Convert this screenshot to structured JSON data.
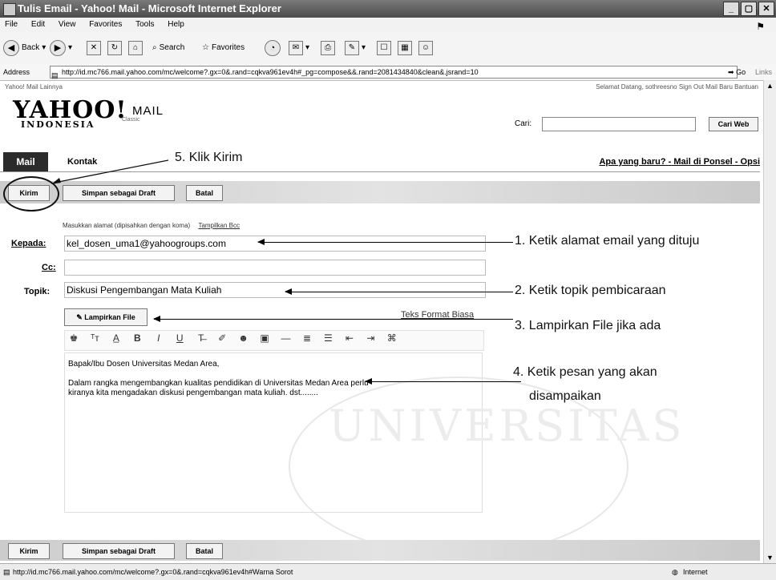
{
  "window": {
    "title": "Tulis Email - Yahoo! Mail - Microsoft Internet Explorer"
  },
  "menu": [
    "File",
    "Edit",
    "View",
    "Favorites",
    "Tools",
    "Help"
  ],
  "toolbar": {
    "back": "Back",
    "search": "Search",
    "favorites": "Favorites"
  },
  "address": {
    "label": "Address",
    "url": "http://id.mc766.mail.yahoo.com/mc/welcome?.gx=0&.rand=cqkva961ev4h#_pg=compose&&.rand=2081434840&clean&.jsrand=10",
    "go": "Go",
    "links": "Links"
  },
  "toplinks": {
    "left": "Yahoo!  Mail  Lainnya",
    "right": "Selamat Datang, sothreesno  Sign Out   Mail Baru   Bantuan"
  },
  "logo": {
    "brand": "YAHOO!",
    "product": "MAIL",
    "region": "INDONESIA",
    "edition": "Classic"
  },
  "search": {
    "label": "Cari:",
    "button": "Cari Web"
  },
  "tabs": {
    "mail": "Mail",
    "kontak": "Kontak"
  },
  "headerlinks": {
    "new": "Apa yang baru?",
    "mobile": "Mail di Ponsel",
    "options": "Opsi",
    "sep": "-"
  },
  "buttons": {
    "send": "Kirim",
    "draft": "Simpan sebagai Draft",
    "cancel": "Batal"
  },
  "form": {
    "hint": "Masukkan alamat (dipisahkan dengan koma)",
    "hint_link": "Tampilkan Bcc",
    "to_label": "Kepada:",
    "to_value": "kel_dosen_uma1@yahoogroups.com",
    "cc_label": "Cc:",
    "cc_value": "",
    "subject_label": "Topik:",
    "subject_value": "Diskusi Pengembangan Mata Kuliah",
    "attach_button": "Lampirkan File",
    "plain_text_link": "Teks Format Biasa",
    "body_line1": "Bapak/Ibu Dosen Universitas Medan Area,",
    "body_line2": "Dalam rangka mengembangkan kualitas pendidikan di Universitas Medan Area perlu",
    "body_line3": "kiranya kita mengadakan diskusi pengembangan mata kuliah. dst........"
  },
  "annotations": {
    "step1": "1. Ketik alamat email yang dituju",
    "step2": "2. Ketik topik pembicaraan",
    "step3": "3. Lampirkan File jika ada",
    "step4a": "4. Ketik pesan yang akan",
    "step4b": "disampaikan",
    "step5": "5. Klik Kirim"
  },
  "status": {
    "url": "http://id.mc766.mail.yahoo.com/mc/welcome?.gx=0&.rand=cqkva961ev4h#Warna Sorot",
    "zone": "Internet"
  },
  "watermark": "UNIVERSITAS"
}
